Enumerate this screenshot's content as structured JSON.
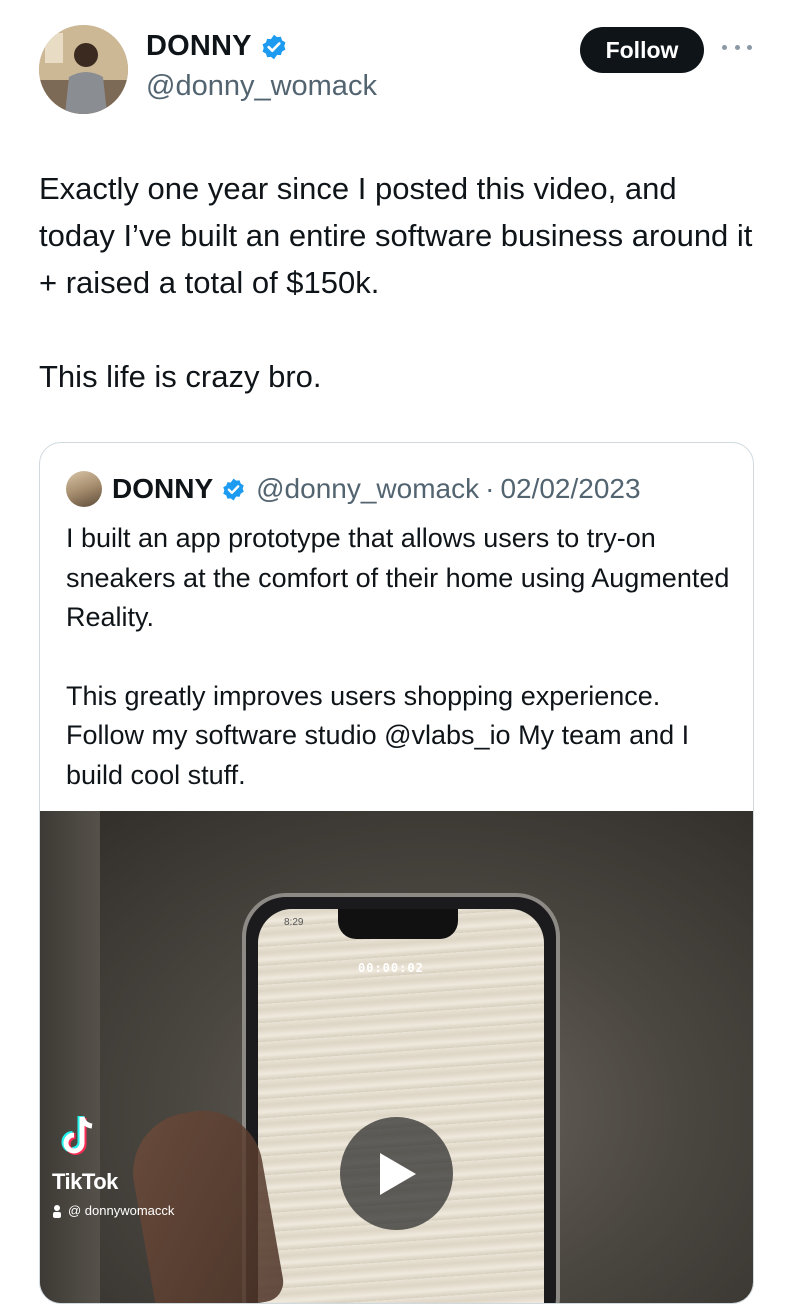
{
  "author": {
    "display_name": "DONNY",
    "handle": "@donny_womack",
    "verified": true
  },
  "actions": {
    "follow_label": "Follow",
    "more_icon": "more-horizontal-icon"
  },
  "tweet": {
    "paragraphs": [
      "Exactly one year since I posted this video, and today I’ve built an entire software business around it + raised a total of $150k.",
      "This life is crazy bro."
    ]
  },
  "quoted_tweet": {
    "display_name": "DONNY",
    "handle": "@donny_womack",
    "separator": "·",
    "date": "02/02/2023",
    "paragraphs": [
      "I built an app prototype that allows users to try-on sneakers at the comfort of their home using Augmented Reality.",
      "This greatly improves users shopping experience. Follow my software studio @vlabs_io My team and I build cool stuff."
    ],
    "media": {
      "type": "video",
      "phone_status_time": "8:29",
      "recording_timer": "00:00:02",
      "watermark_brand": "TikTok",
      "watermark_user": "@ donnywomacck"
    }
  },
  "colors": {
    "text": "#0f1419",
    "secondary": "#536471",
    "verified_blue": "#1d9bf0",
    "border": "#cfd9de"
  }
}
